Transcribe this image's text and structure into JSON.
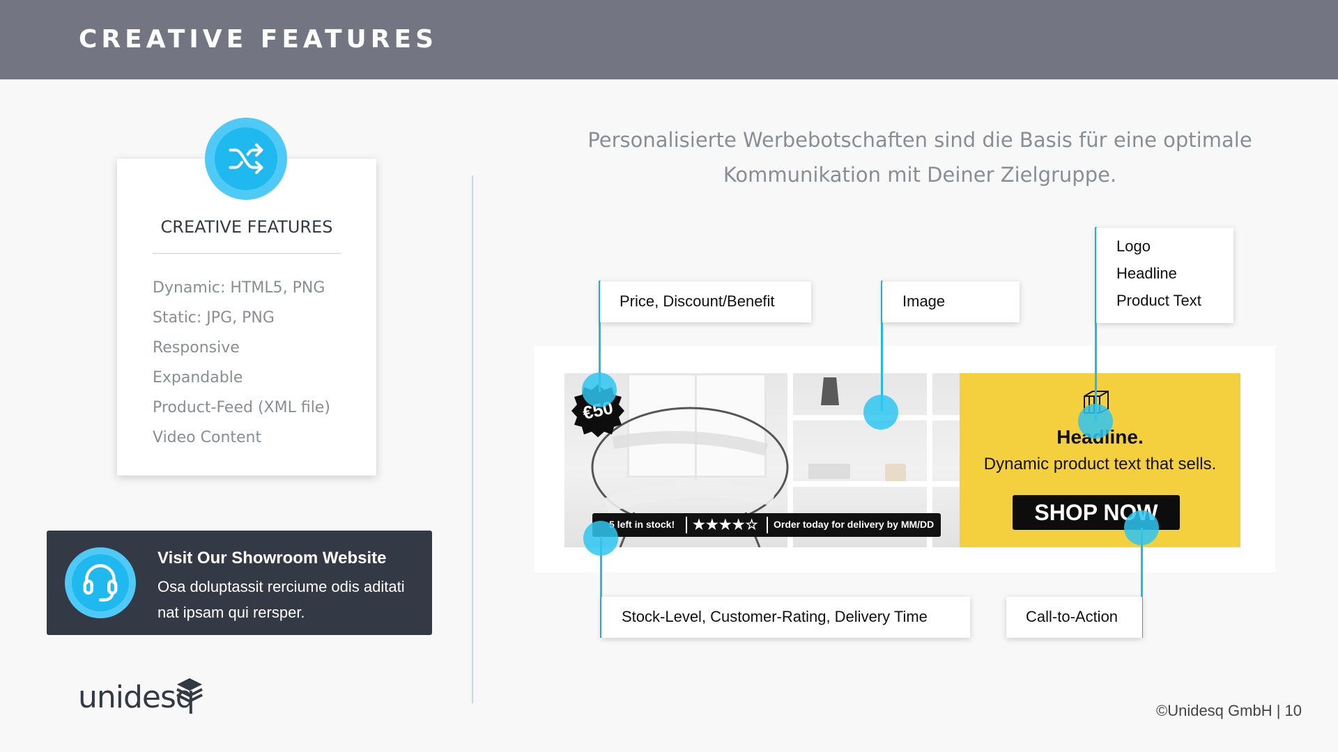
{
  "header": {
    "title": "CREATIVE FEATURES"
  },
  "feature_card": {
    "icon": "shuffle-icon",
    "title": "CREATIVE FEATURES",
    "items": [
      "Dynamic: HTML5, PNG",
      "Static: JPG, PNG",
      "Responsive",
      "Expandable",
      "Product-Feed (XML file)",
      "Video Content"
    ]
  },
  "showroom": {
    "icon": "headset-icon",
    "title": "Visit Our Showroom Website",
    "text": "Osa doluptassit rerciume odis aditati nat ipsam qui rersper."
  },
  "brand": {
    "logo_text": "unidesq",
    "logo_icon": "stacked-layers-icon"
  },
  "footer": {
    "copyright": "©Unidesq GmbH | 10"
  },
  "subtitle": "Personalisierte Werbebotschaften sind die Basis für eine optimale Kommunikation mit Deiner Zielgruppe.",
  "banner": {
    "price_badge": "€50",
    "stock_text": "5 left in stock!",
    "rating": 4,
    "rating_max": 5,
    "delivery_text": "Order today for delivery by MM/DD",
    "headline": "Headline.",
    "product_text": "Dynamic product text that sells.",
    "cta": "SHOP NOW"
  },
  "callouts": {
    "price": "Price, Discount/Benefit",
    "image": "Image",
    "logo_lines": [
      "Logo",
      "Headline",
      "Product Text"
    ],
    "stock": "Stock-Level, Customer-Rating, Delivery Time",
    "cta": "Call-to-Action"
  },
  "colors": {
    "header_bg": "#737682",
    "accent": "#1fb9ef",
    "dark_panel": "#343a45",
    "banner_yellow": "#f4d03f"
  }
}
